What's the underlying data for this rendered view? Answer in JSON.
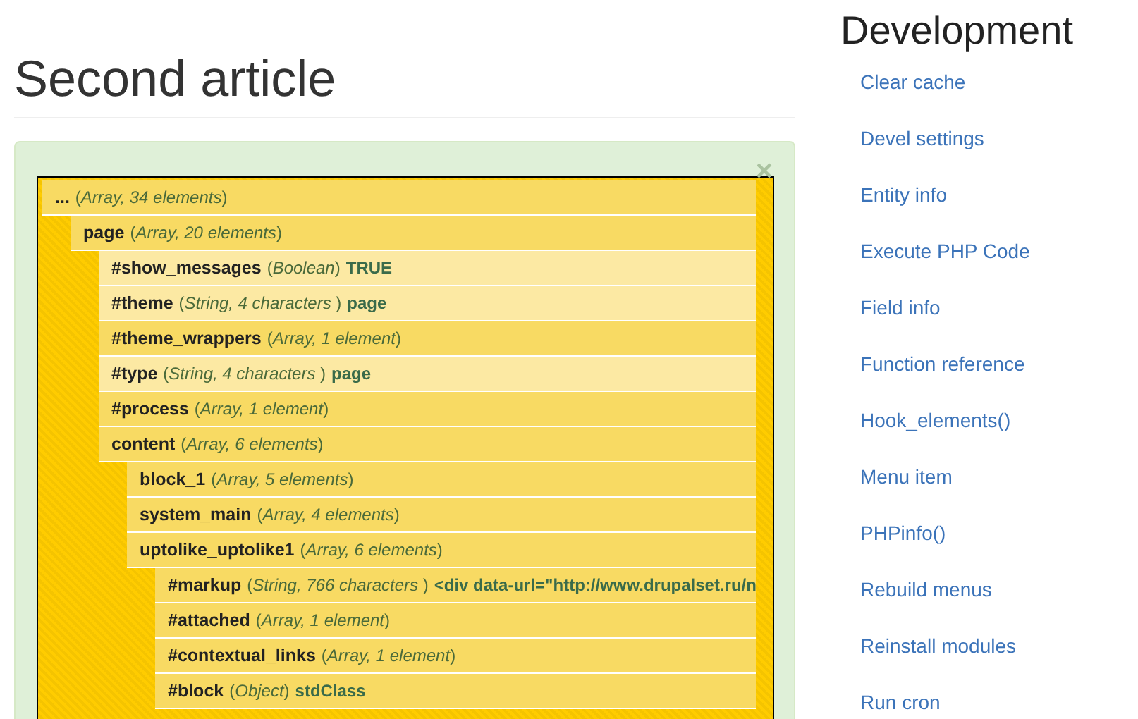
{
  "article": {
    "title": "Second article"
  },
  "dump": {
    "close": "×",
    "tree": [
      {
        "name": "...",
        "type": "(*Array, 34 elements*)",
        "expandable": true,
        "children": [
          {
            "name": "page",
            "type": "(*Array, 20 elements*)",
            "expandable": true,
            "children": [
              {
                "name": "#show_messages",
                "type": "(*Boolean*)",
                "value": "TRUE",
                "expandable": false
              },
              {
                "name": "#theme",
                "type": "(*String, 4 characters* )",
                "value": "page",
                "expandable": false
              },
              {
                "name": "#theme_wrappers",
                "type": "(*Array, 1 element*)",
                "expandable": true
              },
              {
                "name": "#type",
                "type": "(*String, 4 characters* )",
                "value": "page",
                "expandable": false
              },
              {
                "name": "#process",
                "type": "(*Array, 1 element*)",
                "expandable": true
              },
              {
                "name": "content",
                "type": "(*Array, 6 elements*)",
                "expandable": true,
                "children": [
                  {
                    "name": "block_1",
                    "type": "(*Array, 5 elements*)",
                    "expandable": true
                  },
                  {
                    "name": "system_main",
                    "type": "(*Array, 4 elements*)",
                    "expandable": true
                  },
                  {
                    "name": "uptolike_uptolike1",
                    "type": "(*Array, 6 elements*)",
                    "expandable": true,
                    "children": [
                      {
                        "name": "#markup",
                        "type": "(*String, 766 characters* )",
                        "value": "<div data-url=\"http://www.drupalset.ru/n",
                        "expandable": true
                      },
                      {
                        "name": "#attached",
                        "type": "(*Array, 1 element*)",
                        "expandable": true
                      },
                      {
                        "name": "#contextual_links",
                        "type": "(*Array, 1 element*)",
                        "expandable": true
                      },
                      {
                        "name": "#block",
                        "type": "(*Object*)",
                        "value": "stdClass",
                        "expandable": true
                      }
                    ]
                  }
                ]
              }
            ]
          }
        ]
      }
    ]
  },
  "sidebar": {
    "title": "Development",
    "items": [
      "Clear cache",
      "Devel settings",
      "Entity info",
      "Execute PHP Code",
      "Field info",
      "Function reference",
      "Hook_elements()",
      "Menu item",
      "PHPinfo()",
      "Rebuild menus",
      "Reinstall modules",
      "Run cron"
    ]
  }
}
